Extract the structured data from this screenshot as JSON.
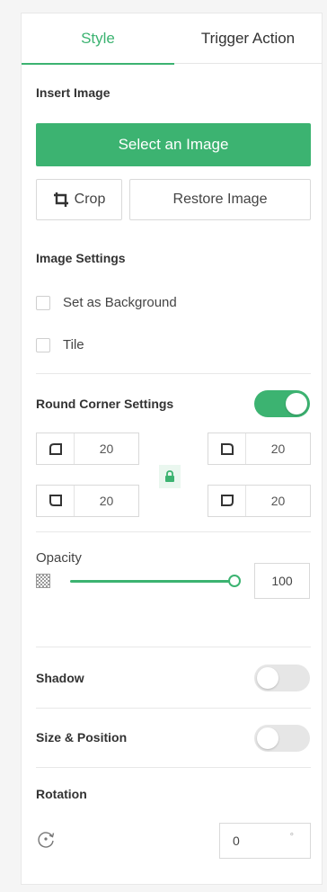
{
  "tabs": {
    "style": "Style",
    "trigger": "Trigger Action"
  },
  "insert_image": {
    "title": "Insert Image",
    "select_label": "Select an Image",
    "crop_label": "Crop",
    "restore_label": "Restore Image"
  },
  "image_settings": {
    "title": "Image Settings",
    "background_label": "Set as Background",
    "tile_label": "Tile"
  },
  "round_corner": {
    "title": "Round Corner Settings",
    "enabled": true,
    "top_left": "20",
    "top_right": "20",
    "bottom_left": "20",
    "bottom_right": "20"
  },
  "opacity": {
    "title": "Opacity",
    "value": "100"
  },
  "shadow": {
    "title": "Shadow",
    "enabled": false
  },
  "size_position": {
    "title": "Size & Position",
    "enabled": false
  },
  "rotation": {
    "title": "Rotation",
    "value": "0",
    "unit": "°"
  },
  "colors": {
    "accent": "#3cb371",
    "border": "#d9d9d9"
  }
}
